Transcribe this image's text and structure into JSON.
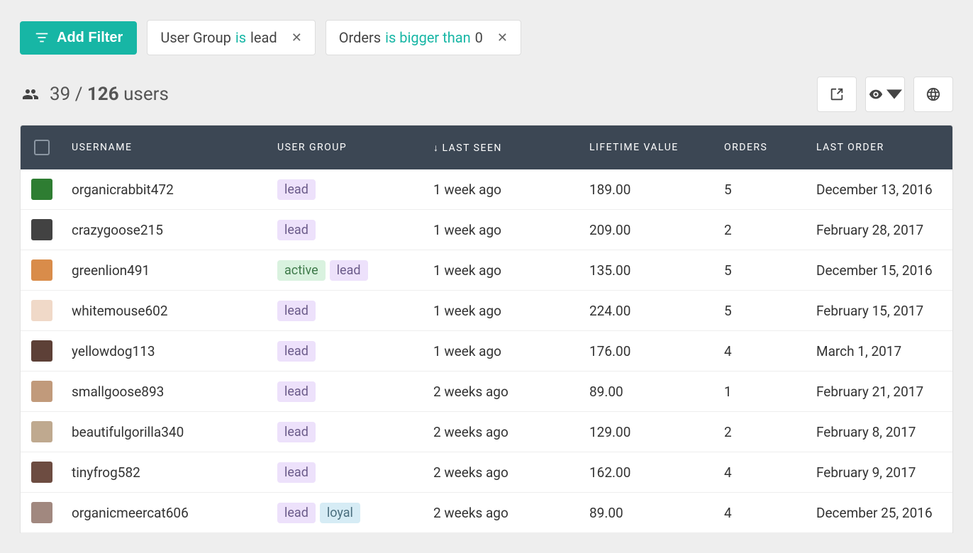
{
  "toolbar": {
    "add_filter_label": "Add Filter"
  },
  "filters": [
    {
      "field": "User Group",
      "op": "is",
      "value": "lead"
    },
    {
      "field": "Orders",
      "op": "is bigger than",
      "value": "0"
    }
  ],
  "summary": {
    "filtered": "39",
    "separator": "/",
    "total": "126",
    "noun": "users"
  },
  "columns": {
    "username": "USERNAME",
    "user_group": "USER GROUP",
    "last_seen": "LAST SEEN",
    "lifetime_value": "LIFETIME VALUE",
    "orders": "ORDERS",
    "last_order": "LAST ORDER",
    "sort_indicator": "↓"
  },
  "badge_labels": {
    "lead": "lead",
    "active": "active",
    "loyal": "loyal"
  },
  "rows": [
    {
      "username": "organicrabbit472",
      "avatar_color": "#2e7d32",
      "groups": [
        "lead"
      ],
      "last_seen": "1 week ago",
      "ltv": "189.00",
      "orders": "5",
      "last_order": "December 13, 2016"
    },
    {
      "username": "crazygoose215",
      "avatar_color": "#424242",
      "groups": [
        "lead"
      ],
      "last_seen": "1 week ago",
      "ltv": "209.00",
      "orders": "2",
      "last_order": "February 28, 2017"
    },
    {
      "username": "greenlion491",
      "avatar_color": "#d98c4a",
      "groups": [
        "active",
        "lead"
      ],
      "last_seen": "1 week ago",
      "ltv": "135.00",
      "orders": "5",
      "last_order": "December 15, 2016"
    },
    {
      "username": "whitemouse602",
      "avatar_color": "#f0d9c8",
      "groups": [
        "lead"
      ],
      "last_seen": "1 week ago",
      "ltv": "224.00",
      "orders": "5",
      "last_order": "February 15, 2017"
    },
    {
      "username": "yellowdog113",
      "avatar_color": "#5d4037",
      "groups": [
        "lead"
      ],
      "last_seen": "1 week ago",
      "ltv": "176.00",
      "orders": "4",
      "last_order": "March 1, 2017"
    },
    {
      "username": "smallgoose893",
      "avatar_color": "#c19a7b",
      "groups": [
        "lead"
      ],
      "last_seen": "2 weeks ago",
      "ltv": "89.00",
      "orders": "1",
      "last_order": "February 21, 2017"
    },
    {
      "username": "beautifulgorilla340",
      "avatar_color": "#bfa98f",
      "groups": [
        "lead"
      ],
      "last_seen": "2 weeks ago",
      "ltv": "129.00",
      "orders": "2",
      "last_order": "February 8, 2017"
    },
    {
      "username": "tinyfrog582",
      "avatar_color": "#6d4c41",
      "groups": [
        "lead"
      ],
      "last_seen": "2 weeks ago",
      "ltv": "162.00",
      "orders": "4",
      "last_order": "February 9, 2017"
    },
    {
      "username": "organicmeercat606",
      "avatar_color": "#a1887f",
      "groups": [
        "lead",
        "loyal"
      ],
      "last_seen": "2 weeks ago",
      "ltv": "89.00",
      "orders": "4",
      "last_order": "December 25, 2016"
    }
  ]
}
